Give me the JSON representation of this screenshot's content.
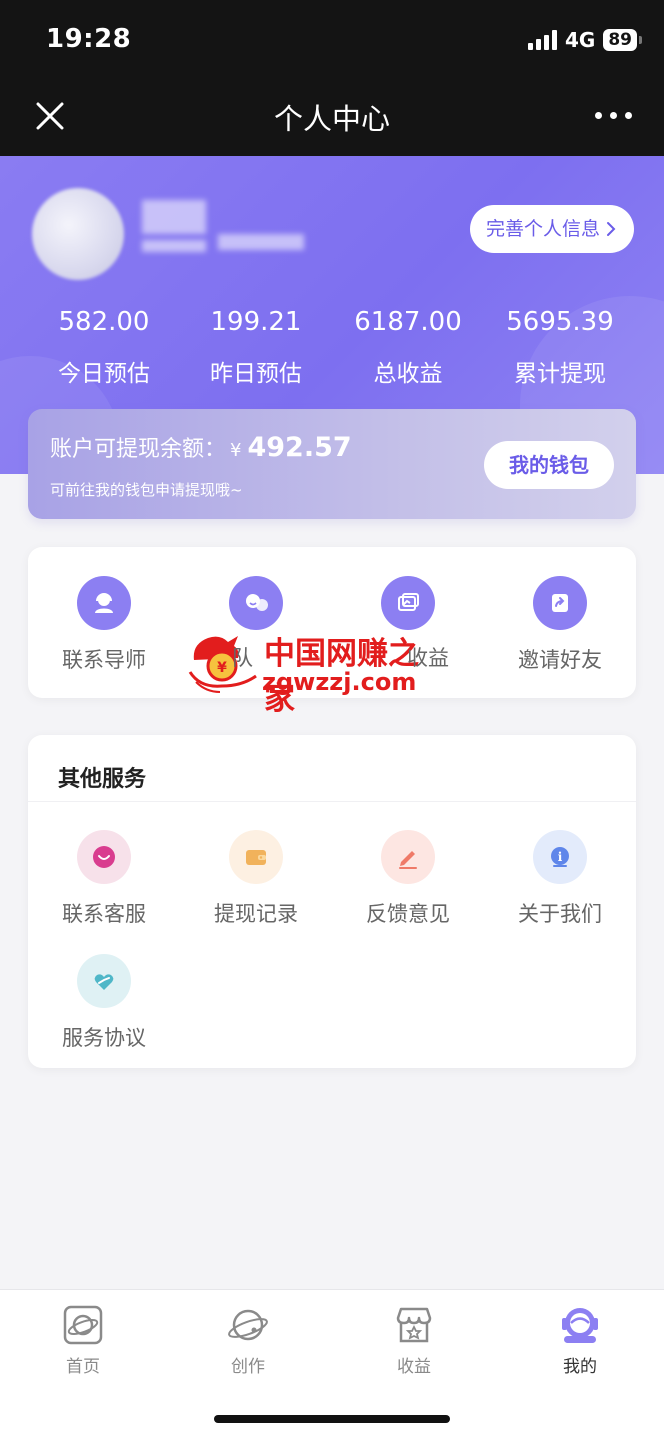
{
  "status_bar": {
    "time": "19:28",
    "network": "4G",
    "battery": "89"
  },
  "nav": {
    "title": "个人中心"
  },
  "profile": {
    "edit_label": "完善个人信息"
  },
  "stats": [
    {
      "value": "582.00",
      "label": "今日预估"
    },
    {
      "value": "199.21",
      "label": "昨日预估"
    },
    {
      "value": "6187.00",
      "label": "总收益"
    },
    {
      "value": "5695.39",
      "label": "累计提现"
    }
  ],
  "balance": {
    "label": "账户可提现余额：",
    "currency": "¥",
    "amount": "492.57",
    "hint": "可前往我的钱包申请提现哦~",
    "wallet_label": "我的钱包"
  },
  "quick_actions": [
    {
      "label": "联系导师",
      "icon": "headset-icon",
      "color": "#8c7ff2"
    },
    {
      "label": "队伍",
      "icon": "team-icon",
      "color": "#8c7ff2"
    },
    {
      "label": "收益",
      "icon": "earnings-icon",
      "color": "#8c7ff2"
    },
    {
      "label": "邀请好友",
      "icon": "share-icon",
      "color": "#8c7ff2"
    }
  ],
  "watermark": {
    "cn": "中国网赚之家",
    "domain": "zgwzzj.com"
  },
  "other_services": {
    "title": "其他服务",
    "items": [
      {
        "label": "联系客服",
        "icon": "chat-icon",
        "color": "#d93d8f"
      },
      {
        "label": "提现记录",
        "icon": "wallet-icon",
        "color": "#f1b25b"
      },
      {
        "label": "反馈意见",
        "icon": "pencil-icon",
        "color": "#ef7a68"
      },
      {
        "label": "关于我们",
        "icon": "info-icon",
        "color": "#5f86ea"
      },
      {
        "label": "服务协议",
        "icon": "heart-hand-icon",
        "color": "#4fb7c8"
      }
    ]
  },
  "tabbar": [
    {
      "label": "首页",
      "icon": "home-planet-icon",
      "active": false
    },
    {
      "label": "创作",
      "icon": "create-planet-icon",
      "active": false
    },
    {
      "label": "收益",
      "icon": "shop-icon",
      "active": false
    },
    {
      "label": "我的",
      "icon": "astronaut-icon",
      "active": true
    }
  ]
}
